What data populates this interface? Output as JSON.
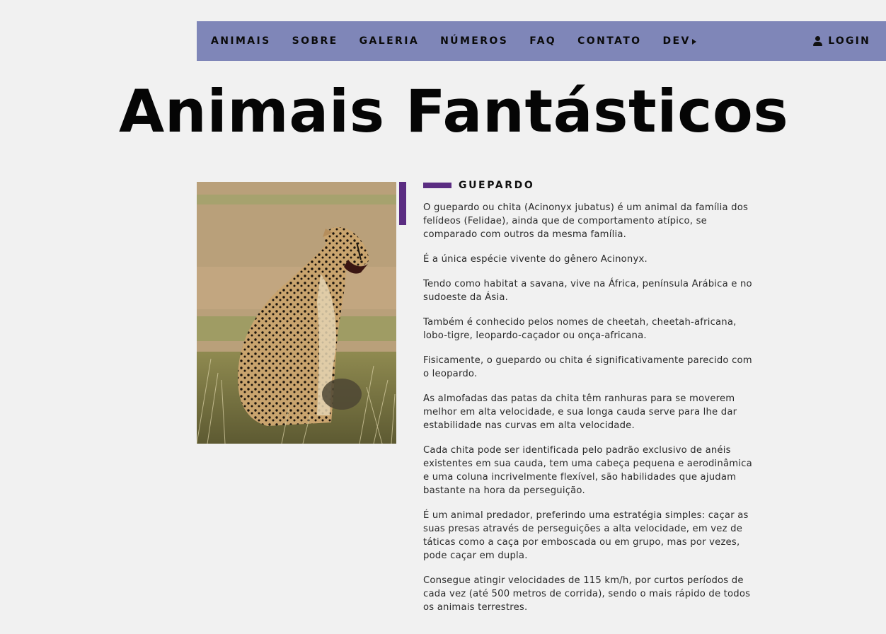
{
  "nav": {
    "items": [
      {
        "label": "ANIMAIS"
      },
      {
        "label": "SOBRE"
      },
      {
        "label": "GALERIA"
      },
      {
        "label": "NÚMEROS"
      },
      {
        "label": "FAQ"
      },
      {
        "label": "CONTATO"
      },
      {
        "label": "DEV"
      }
    ],
    "login_label": "LOGIN",
    "background": "#7f86b8"
  },
  "title": "Animais Fantásticos",
  "accent_color": "#5b2d82",
  "article": {
    "heading": "GUEPARDO",
    "paragraphs": [
      "O guepardo ou chita (Acinonyx jubatus) é um animal da família dos felídeos (Felidae), ainda que de comportamento atípico, se comparado com outros da mesma família.",
      "É a única espécie vivente do gênero Acinonyx.",
      "Tendo como habitat a savana, vive na África, península Arábica e no sudoeste da Ásia.",
      "Também é conhecido pelos nomes de cheetah, cheetah-africana, lobo-tigre, leopardo-caçador ou onça-africana.",
      "Fisicamente, o guepardo ou chita é significativamente parecido com o leopardo.",
      "As almofadas das patas da chita têm ranhuras para se moverem melhor em alta velocidade, e sua longa cauda serve para lhe dar estabilidade nas curvas em alta velocidade.",
      "Cada chita pode ser identificada pelo padrão exclusivo de anéis existentes em sua cauda, tem uma cabeça pequena e aerodinâmica e uma coluna incrivelmente flexível, são habilidades que ajudam bastante na hora da perseguição.",
      "É um animal predador, preferindo uma estratégia simples: caçar as suas presas através de perseguições a alta velocidade, em vez de táticas como a caça por emboscada ou em grupo, mas por vezes, pode caçar em dupla.",
      "Consegue atingir velocidades de 115 km/h, por curtos períodos de cada vez (até 500 metros de corrida), sendo o mais rápido de todos os animais terrestres."
    ]
  },
  "icons": {
    "login": "user-icon",
    "dev_dropdown": "caret-right-icon"
  }
}
